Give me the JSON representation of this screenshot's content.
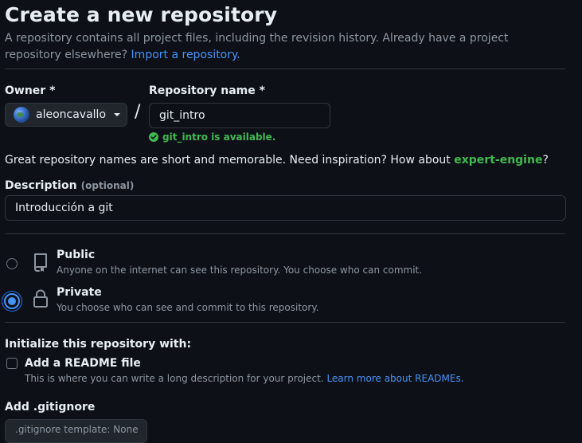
{
  "header": {
    "title": "Create a new repository",
    "description": "A repository contains all project files, including the revision history. Already have a project repository elsewhere?",
    "import_link": "Import a repository."
  },
  "owner": {
    "label": "Owner *",
    "value": "aleoncavallo"
  },
  "separator": "/",
  "repo_name": {
    "label": "Repository name *",
    "value": "git_intro",
    "availability": "git_intro is available."
  },
  "suggestion": {
    "text_before": "Great repository names are short and memorable. Need inspiration? How about",
    "name": "expert-engine",
    "text_after": "?"
  },
  "description": {
    "label": "Description",
    "optional": "(optional)",
    "value": "Introducción a git"
  },
  "visibility": {
    "selected": "private",
    "public": {
      "title": "Public",
      "desc": "Anyone on the internet can see this repository. You choose who can commit."
    },
    "private": {
      "title": "Private",
      "desc": "You choose who can see and commit to this repository."
    }
  },
  "initialize": {
    "heading": "Initialize this repository with:",
    "readme": {
      "label": "Add a README file",
      "checked": false,
      "desc": "This is where you can write a long description for your project.",
      "link": "Learn more about READMEs."
    }
  },
  "gitignore": {
    "label": "Add .gitignore",
    "template_button": ".gitignore template: None"
  },
  "colors": {
    "background": "#0d1117",
    "accent_blue": "#4493f8",
    "success_green": "#3fb950",
    "border": "#30363d"
  }
}
